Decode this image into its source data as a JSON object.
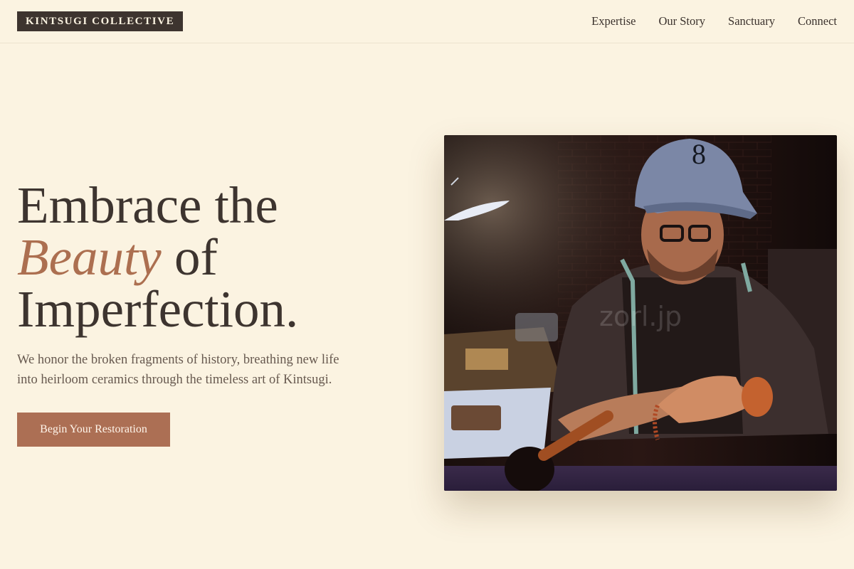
{
  "brand": {
    "logo": "KINTSUGI COLLECTIVE"
  },
  "nav": [
    {
      "label": "Expertise"
    },
    {
      "label": "Our Story"
    },
    {
      "label": "Sanctuary"
    },
    {
      "label": "Connect"
    }
  ],
  "hero": {
    "title_line1": "Embrace the",
    "title_accent": "Beauty",
    "title_line2_rest": " of",
    "title_line3": "Imperfection.",
    "subtitle": "We honor the broken fragments of history, breathing new life into heirloom ceramics through the timeless art of Kintsugi.",
    "cta_label": "Begin Your Restoration"
  },
  "photo": {
    "watermark": "zorl.jp"
  },
  "colors": {
    "background": "#fbf3e1",
    "ink": "#3d342f",
    "accent": "#ac6f50"
  }
}
